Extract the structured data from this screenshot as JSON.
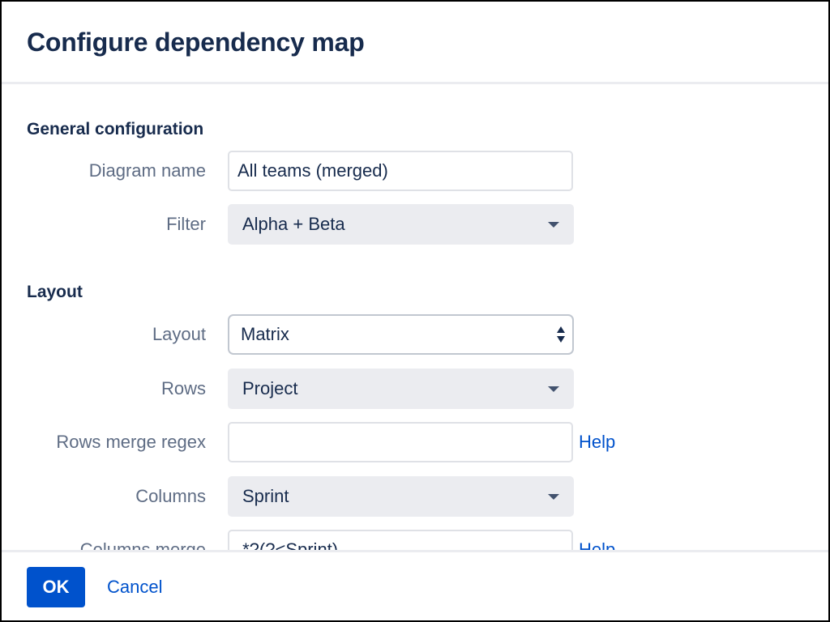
{
  "dialog": {
    "title": "Configure dependency map"
  },
  "general": {
    "heading": "General configuration",
    "diagram_name": {
      "label": "Diagram name",
      "value": "All teams (merged)"
    },
    "filter": {
      "label": "Filter",
      "value": "Alpha + Beta",
      "icon": "chevron-down-icon"
    }
  },
  "layout": {
    "heading": "Layout",
    "layout_field": {
      "label": "Layout",
      "value": "Matrix",
      "icon": "select-updown-icon"
    },
    "rows": {
      "label": "Rows",
      "value": "Project",
      "icon": "chevron-down-icon"
    },
    "rows_merge_regex": {
      "label": "Rows merge regex",
      "value": "",
      "help": "Help"
    },
    "columns": {
      "label": "Columns",
      "value": "Sprint",
      "icon": "chevron-down-icon"
    },
    "columns_merge": {
      "label": "Columns merge",
      "value": ".*?(?<Sprint)",
      "help": "Help"
    }
  },
  "footer": {
    "ok_label": "OK",
    "cancel_label": "Cancel"
  },
  "colors": {
    "primary": "#0052cc",
    "text": "#172b4d",
    "label": "#5e6c84",
    "dropdown_bg": "#ebecf0",
    "divider": "#ebecf0"
  }
}
